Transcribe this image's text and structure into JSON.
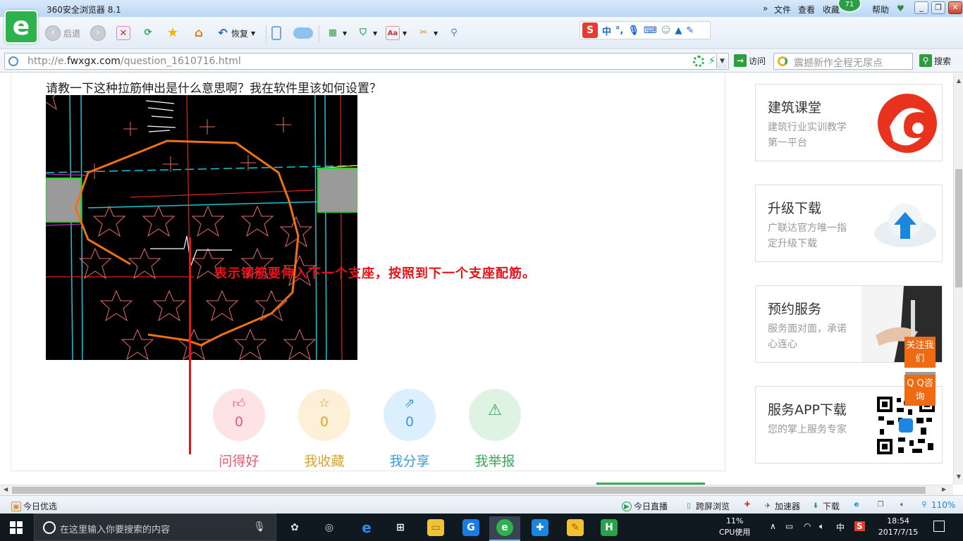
{
  "browser": {
    "title": "360安全浏览器 8.1",
    "menu": [
      "文件",
      "查看",
      "收藏",
      "帮助"
    ],
    "badge": "71",
    "window_buttons": [
      "minimize",
      "restore",
      "close"
    ]
  },
  "toolbar": {
    "back_label": "后退",
    "restore_label": "恢复",
    "icons": [
      "back-icon",
      "forward-icon",
      "stop-icon",
      "refresh-icon",
      "favorite-star-icon",
      "home-icon",
      "restore-icon",
      "phone-icon",
      "cloud-icon",
      "apps-icon",
      "shield-icon",
      "translate-icon",
      "screenshot-icon",
      "zoom-icon"
    ]
  },
  "ime_bar": {
    "logo": "S",
    "lang": "中",
    "items": [
      "punctuation-icon",
      "mic-icon",
      "keyboard-icon",
      "user-icon",
      "skin-icon",
      "tools-icon"
    ]
  },
  "address": {
    "prefix": "http://e.",
    "domain": "fwxgx.com",
    "path": "/question_1610716.html",
    "go_label": "访问",
    "search_placeholder": "震撼新作全程无尿点",
    "search_button": "搜索"
  },
  "question": {
    "text": "请教一下这种拉筋伸出是什么意思啊？我在软件里该如何设置？",
    "annotation": "表示钢筋要伸入下一个支座，按照到下一个支座配筋。"
  },
  "actions": [
    {
      "label": "问得好",
      "count": "0",
      "icon": "thumbs-up-icon",
      "bg": "#fde3e6",
      "color": "#e25b6f"
    },
    {
      "label": "我收藏",
      "count": "0",
      "icon": "star-icon",
      "bg": "#fdf0d8",
      "color": "#e0a22e"
    },
    {
      "label": "我分享",
      "count": "0",
      "icon": "share-icon",
      "bg": "#dbf0fc",
      "color": "#3a9bd9"
    },
    {
      "label": "我举报",
      "count": "",
      "icon": "warning-icon",
      "bg": "#dff3e3",
      "color": "#3aa858"
    }
  ],
  "sidebar": [
    {
      "title": "建筑课堂",
      "desc": "建筑行业实训教学第一平台",
      "icon": "course-logo-icon"
    },
    {
      "title": "升级下载",
      "desc": "广联达官方唯一指定升级下载",
      "icon": "cloud-upload-icon"
    },
    {
      "title": "预约服务",
      "desc": "服务面对面，承诺心连心",
      "icon": "handshake-photo"
    },
    {
      "title": "服务APP下载",
      "desc": "您的掌上服务专家",
      "icon": "qr-code-icon"
    }
  ],
  "float": {
    "follow": "关注我们",
    "qq": "Q Q咨询"
  },
  "statusbar": {
    "left": "今日优选",
    "items": [
      "今日直播",
      "跨屏浏览",
      "加速器",
      "下载"
    ],
    "zoom": "110%"
  },
  "taskbar": {
    "search_placeholder": "在这里输入你要搜索的内容",
    "cpu_percent": "11%",
    "cpu_label": "CPU使用",
    "ime": "中",
    "time": "18:54",
    "date": "2017/7/15"
  },
  "colors": {
    "accent_green": "#2eb24e",
    "annotation_red": "#e8121b",
    "float_orange": "#f06a12"
  }
}
